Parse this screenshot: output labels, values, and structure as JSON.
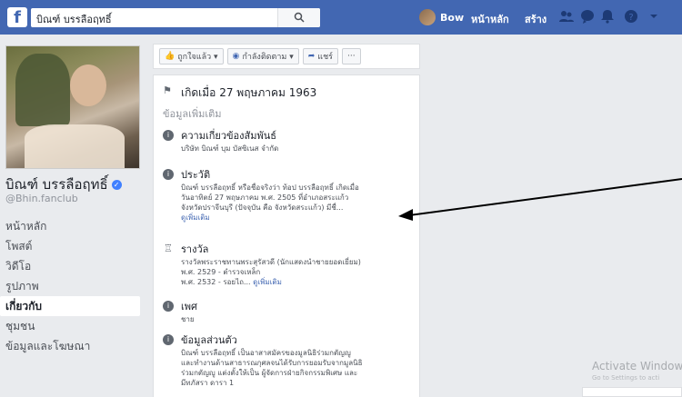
{
  "topbar": {
    "logo": "f",
    "search_value": "บิณฑ์ บรรลือฤทธิ์",
    "user_name": "Bow",
    "home_label": "หน้าหลัก",
    "create_label": "สร้าง"
  },
  "profile": {
    "name": "บิณฑ์ บรรลือฤทธิ์",
    "handle": "@Bhin.fanclub"
  },
  "sidebar": {
    "items": [
      {
        "label": "หน้าหลัก"
      },
      {
        "label": "โพสต์"
      },
      {
        "label": "วิดีโอ"
      },
      {
        "label": "รูปภาพ"
      },
      {
        "label": "เกี่ยวกับ"
      },
      {
        "label": "ชุมชน"
      },
      {
        "label": "ข้อมูลและโฆษณา"
      }
    ]
  },
  "actions": {
    "like": "ถูกใจแล้ว ▾",
    "follow": "กำลังติดตาม ▾",
    "share": "แชร์",
    "more": "···"
  },
  "about": {
    "birth": "เกิดเมื่อ 27 พฤษภาคม 1963",
    "more_info_title": "ข้อมูลเพิ่มเติม",
    "relation_title": "ความเกี่ยวข้องสัมพันธ์",
    "relation_body": "บริษัท บิณฑ์ บุม บัสซิเนส จำกัด",
    "bio_title": "ประวัติ",
    "bio_l1": "บิณฑ์ บรรลือฤทธิ์ หรือชื่อจริงว่า ท้อป บรรลือฤทธิ์ เกิดเมื่อ",
    "bio_l2": "วันอาทิตย์ 27 พฤษภาคม พ.ศ. 2505 ที่อำเภอสระแก้ว",
    "bio_l3": "จังหวัดปราจีนบุรี (ปัจจุบัน คือ จังหวัดสระแก้ว) มีชื่...",
    "bio_more": "ดูเพิ่มเติม",
    "award_title": "รางวัล",
    "award_l1": "รางวัลพระราชทานพระสุรัสวดี (นักแสดงนำชายยอดเยี่ยม)",
    "award_l2": "พ.ศ. 2529 - ตำรวจเหล็ก",
    "award_l3": "พ.ศ. 2532 - รอยไถ...",
    "award_more": "ดูเพิ่มเติม",
    "gender_title": "เพศ",
    "gender_value": "ชาย",
    "personal_title": "ข้อมูลส่วนตัว",
    "personal_l1": "บิณฑ์ บรรลือฤทธิ์ เป็นอาสาสมัครของมูลนิธิร่วมกตัญญู",
    "personal_l2": "และทำงานด้านสาธารณกุศลจนได้รับการยอมรับจากมูลนิธิ",
    "personal_l3": "ร่วมกตัญญู แต่งตั้งให้เป็น ผู้จัดการฝ่ายกิจกรรมพิเศษ และ",
    "personal_l4": "มีทภัสรา ดารา 1"
  },
  "watermark": {
    "line1": "Activate Window",
    "line2": "Go to Settings to acti"
  },
  "colors": {
    "topbar": "#4267b2",
    "background": "#e9ebee",
    "link": "#4267b2",
    "verified": "#4080ff"
  }
}
